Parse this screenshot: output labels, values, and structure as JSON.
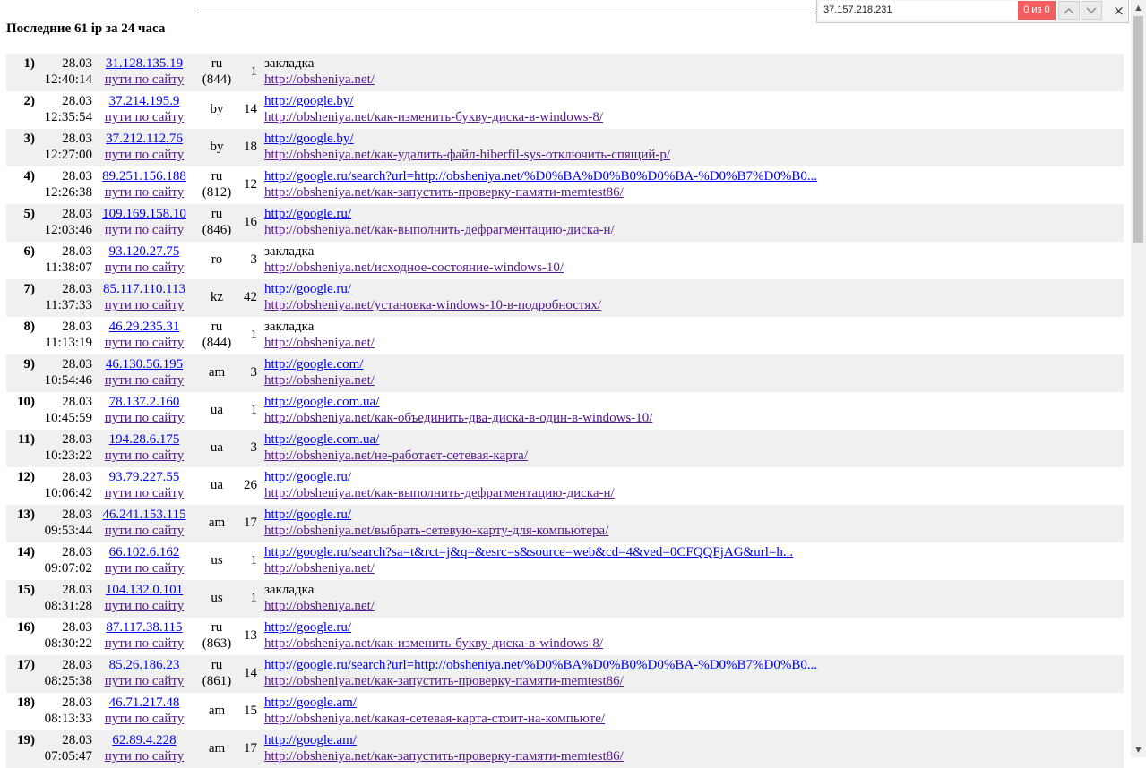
{
  "title": "Последние 61 ip за 24 часа",
  "find": {
    "query": "37.157.218.231",
    "count": "0 из 0",
    "prev_icon": "chevron-up-icon",
    "next_icon": "chevron-down-icon",
    "close": "×"
  },
  "paths_label": "пути по сайту",
  "rows": [
    {
      "n": "1)",
      "date": "28.03",
      "time": "12:40:14",
      "ip": "31.128.135.19",
      "cc": "ru",
      "code": "(844)",
      "count": "1",
      "ref": "закладка",
      "ref_link": false,
      "page": "http://obsheniya.net/"
    },
    {
      "n": "2)",
      "date": "28.03",
      "time": "12:35:54",
      "ip": "37.214.195.9",
      "cc": "by",
      "code": "",
      "count": "14",
      "ref": "http://google.by/",
      "ref_link": true,
      "page": "http://obsheniya.net/как-изменить-букву-диска-в-windows-8/"
    },
    {
      "n": "3)",
      "date": "28.03",
      "time": "12:27:00",
      "ip": "37.212.112.76",
      "cc": "by",
      "code": "",
      "count": "18",
      "ref": "http://google.by/",
      "ref_link": true,
      "page": "http://obsheniya.net/как-удалить-файл-hiberfil-sys-отключить-спящий-р/"
    },
    {
      "n": "4)",
      "date": "28.03",
      "time": "12:26:38",
      "ip": "89.251.156.188",
      "cc": "ru",
      "code": "(812)",
      "count": "12",
      "ref": "http://google.ru/search?url=http://obsheniya.net/%D0%BA%D0%B0%D0%BA-%D0%B7%D0%B0...",
      "ref_link": true,
      "page": "http://obsheniya.net/как-запустить-проверку-памяти-memtest86/"
    },
    {
      "n": "5)",
      "date": "28.03",
      "time": "12:03:46",
      "ip": "109.169.158.10",
      "cc": "ru",
      "code": "(846)",
      "count": "16",
      "ref": "http://google.ru/",
      "ref_link": true,
      "page": "http://obsheniya.net/как-выполнить-дефрагментацию-диска-н/"
    },
    {
      "n": "6)",
      "date": "28.03",
      "time": "11:38:07",
      "ip": "93.120.27.75",
      "cc": "ro",
      "code": "",
      "count": "3",
      "ref": "закладка",
      "ref_link": false,
      "page": "http://obsheniya.net/исходное-состояние-windows-10/"
    },
    {
      "n": "7)",
      "date": "28.03",
      "time": "11:37:33",
      "ip": "85.117.110.113",
      "cc": "kz",
      "code": "",
      "count": "42",
      "ref": "http://google.ru/",
      "ref_link": true,
      "page": "http://obsheniya.net/установка-windows-10-в-подробностях/"
    },
    {
      "n": "8)",
      "date": "28.03",
      "time": "11:13:19",
      "ip": "46.29.235.31",
      "cc": "ru",
      "code": "(844)",
      "count": "1",
      "ref": "закладка",
      "ref_link": false,
      "page": "http://obsheniya.net/"
    },
    {
      "n": "9)",
      "date": "28.03",
      "time": "10:54:46",
      "ip": "46.130.56.195",
      "cc": "am",
      "code": "",
      "count": "3",
      "ref": "http://google.com/",
      "ref_link": true,
      "page": "http://obsheniya.net/"
    },
    {
      "n": "10)",
      "date": "28.03",
      "time": "10:45:59",
      "ip": "78.137.2.160",
      "cc": "ua",
      "code": "",
      "count": "1",
      "ref": "http://google.com.ua/",
      "ref_link": true,
      "page": "http://obsheniya.net/как-объединить-два-диска-в-один-в-windows-10/"
    },
    {
      "n": "11)",
      "date": "28.03",
      "time": "10:23:22",
      "ip": "194.28.6.175",
      "cc": "ua",
      "code": "",
      "count": "3",
      "ref": "http://google.com.ua/",
      "ref_link": true,
      "page": "http://obsheniya.net/не-работает-сетевая-карта/"
    },
    {
      "n": "12)",
      "date": "28.03",
      "time": "10:06:42",
      "ip": "93.79.227.55",
      "cc": "ua",
      "code": "",
      "count": "26",
      "ref": "http://google.ru/",
      "ref_link": true,
      "page": "http://obsheniya.net/как-выполнить-дефрагментацию-диска-н/"
    },
    {
      "n": "13)",
      "date": "28.03",
      "time": "09:53:44",
      "ip": "46.241.153.115",
      "cc": "am",
      "code": "",
      "count": "17",
      "ref": "http://google.ru/",
      "ref_link": true,
      "page": "http://obsheniya.net/выбрать-сетевую-карту-для-компьютера/"
    },
    {
      "n": "14)",
      "date": "28.03",
      "time": "09:07:02",
      "ip": "66.102.6.162",
      "cc": "us",
      "code": "",
      "count": "1",
      "ref": "http://google.ru/search?sa=t&rct=j&q=&esrc=s&source=web&cd=4&ved=0CFQQFjAG&url=h...",
      "ref_link": true,
      "page": "http://obsheniya.net/"
    },
    {
      "n": "15)",
      "date": "28.03",
      "time": "08:31:28",
      "ip": "104.132.0.101",
      "cc": "us",
      "code": "",
      "count": "1",
      "ref": "закладка",
      "ref_link": false,
      "page": "http://obsheniya.net/"
    },
    {
      "n": "16)",
      "date": "28.03",
      "time": "08:30:22",
      "ip": "87.117.38.115",
      "cc": "ru",
      "code": "(863)",
      "count": "13",
      "ref": "http://google.ru/",
      "ref_link": true,
      "page": "http://obsheniya.net/как-изменить-букву-диска-в-windows-8/"
    },
    {
      "n": "17)",
      "date": "28.03",
      "time": "08:25:38",
      "ip": "85.26.186.23",
      "cc": "ru",
      "code": "(861)",
      "count": "14",
      "ref": "http://google.ru/search?url=http://obsheniya.net/%D0%BA%D0%B0%D0%BA-%D0%B7%D0%B0...",
      "ref_link": true,
      "page": "http://obsheniya.net/как-запустить-проверку-памяти-memtest86/"
    },
    {
      "n": "18)",
      "date": "28.03",
      "time": "08:13:33",
      "ip": "46.71.217.48",
      "cc": "am",
      "code": "",
      "count": "15",
      "ref": "http://google.am/",
      "ref_link": true,
      "page": "http://obsheniya.net/какая-сетевая-карта-стоит-на-компьюте/"
    },
    {
      "n": "19)",
      "date": "28.03",
      "time": "07:05:47",
      "ip": "62.89.4.228",
      "cc": "am",
      "code": "",
      "count": "17",
      "ref": "http://google.am/",
      "ref_link": true,
      "page": "http://obsheniya.net/как-запустить-проверку-памяти-memtest86/"
    }
  ],
  "colors": {
    "alt_row": "#f0f0f0",
    "link": "#0000ee",
    "visited": "#551a8b",
    "find_count_bg": "#f05e5e"
  }
}
